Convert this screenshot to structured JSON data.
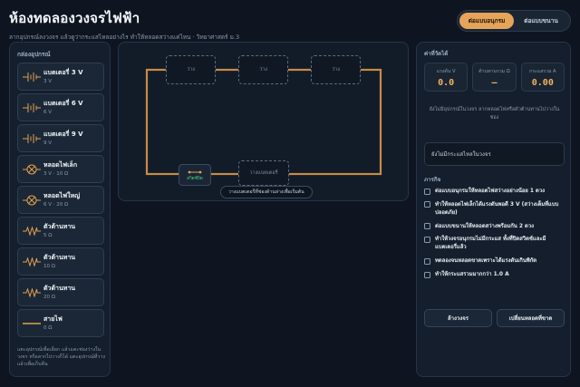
{
  "header": {
    "title": "ห้องทดลองวงจรไฟฟ้า",
    "subtitle": "ลากอุปกรณ์ลงวงจร แล้วดูว่ากระแสไหลอย่างไร ทำให้หลอดสว่างแค่ไหน · วิทยาศาสตร์ ม.3"
  },
  "modes": [
    {
      "label": "ต่อแบบอนุกรม",
      "active": true
    },
    {
      "label": "ต่อแบบขนาน",
      "active": false
    }
  ],
  "toolbox": {
    "title": "กล่องอุปกรณ์",
    "items": [
      {
        "name": "แบตเตอรี่ 3 V",
        "spec": "3 V",
        "icon": "battery-icon"
      },
      {
        "name": "แบตเตอรี่ 6 V",
        "spec": "6 V",
        "icon": "battery-icon"
      },
      {
        "name": "แบตเตอรี่ 9 V",
        "spec": "9 V",
        "icon": "battery-icon"
      },
      {
        "name": "หลอดไฟเล็ก",
        "spec": "3 V · 10 Ω",
        "icon": "bulb-icon"
      },
      {
        "name": "หลอดไฟใหญ่",
        "spec": "6 V · 20 Ω",
        "icon": "bulb-icon"
      },
      {
        "name": "ตัวต้านทาน",
        "spec": "5 Ω",
        "icon": "resistor-icon"
      },
      {
        "name": "ตัวต้านทาน",
        "spec": "10 Ω",
        "icon": "resistor-icon"
      },
      {
        "name": "ตัวต้านทาน",
        "spec": "20 Ω",
        "icon": "resistor-icon"
      },
      {
        "name": "สายไฟ",
        "spec": "0 Ω",
        "icon": "wire-icon"
      }
    ],
    "note": "แตะอุปกรณ์เพื่อเลือก แล้วแตะช่องว่างในวงจร หรือลากไปวางก็ได้ แตะอุปกรณ์ที่วางแล้วเพื่อเก็บคืน"
  },
  "board": {
    "slots_top": [
      "ว่าง",
      "ว่าง",
      "ว่าง"
    ],
    "switch_label": "สวิตช์ปิด",
    "bottom_slot": "วางแบตเตอรี่",
    "hint": "วางแบตเตอรี่ที่ช่องด้านล่างเพื่อเริ่มต้น"
  },
  "readings": {
    "title": "ค่าที่วัดได้",
    "items": [
      {
        "label": "แรงดัน V",
        "value": "0.0"
      },
      {
        "label": "ต้านทานรวม Ω",
        "value": "—"
      },
      {
        "label": "กระแสรวม A",
        "value": "0.00"
      }
    ],
    "status": "ยังไม่มีอุปกรณ์ในวงจร ลากหลอดไฟหรือตัวต้านทานไปวางในช่อง",
    "mode_box": "ยังไม่มีกระแสไหลในวงจร"
  },
  "tasks": {
    "title": "ภารกิจ",
    "items": [
      "ต่อแบบอนุกรมให้หลอดไฟสว่างอย่างน้อย 1 ดวง",
      "ทำให้หลอดไฟเล็กได้แรงดันพอดี 3 V (สว่างเต็มที่แบบปลอดภัย)",
      "ต่อแบบขนานให้หลอดสว่างพร้อมกัน 2 ดวง",
      "ทำให้วงจรอนุกรมไม่มีกระแส ทั้งที่ปิดสวิตช์และมีแบตเตอรี่แล้ว",
      "ทดลองจนหลอดขาดเพราะได้แรงดันเกินพิกัด",
      "ทำให้กระแสรวมมากกว่า 1.0 A"
    ]
  },
  "buttons": {
    "clear": "ล้างวงจร",
    "replace": "เปลี่ยนหลอดที่ขาด"
  },
  "colors": {
    "wire": "#c98a45",
    "accent": "#e6a45a",
    "switch_off": "#4fd37c"
  }
}
